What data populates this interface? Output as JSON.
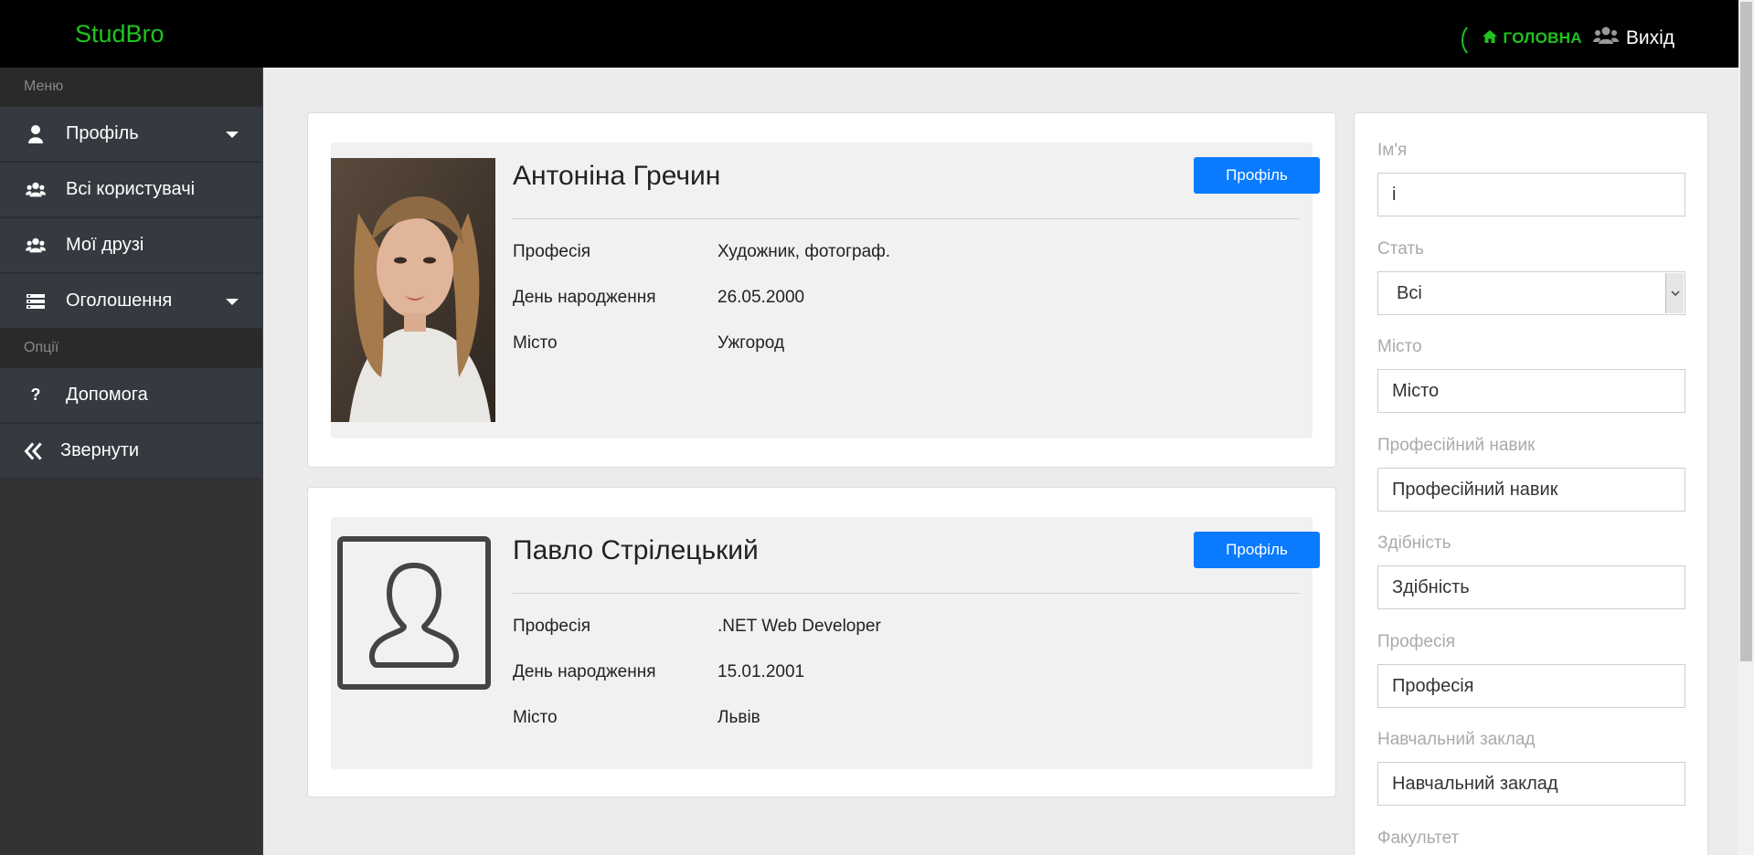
{
  "header": {
    "brand": "StudBro",
    "home_label": "ГОЛОВНА",
    "logout_label": "Вихід"
  },
  "sidebar": {
    "menu_title": "Меню",
    "options_title": "Опції",
    "items": [
      {
        "label": "Профіль",
        "icon": "user-icon",
        "has_caret": true
      },
      {
        "label": "Всі користувачі",
        "icon": "users-icon"
      },
      {
        "label": "Мої друзі",
        "icon": "users-icon"
      },
      {
        "label": "Оголошення",
        "icon": "list-icon",
        "has_caret": true
      }
    ],
    "option_items": [
      {
        "label": "Допомога",
        "icon": "question-icon"
      },
      {
        "label": "Звернути",
        "icon": "double-chevron-left-icon"
      }
    ]
  },
  "people": [
    {
      "name": "Антоніна Гречин",
      "button": "Профіль",
      "fields": [
        {
          "label": "Професія",
          "value": "Художник, фотограф."
        },
        {
          "label": "День народження",
          "value": "26.05.2000"
        },
        {
          "label": "Місто",
          "value": "Ужгород"
        }
      ]
    },
    {
      "name": "Павло Стрілецький",
      "button": "Профіль",
      "fields": [
        {
          "label": "Професія",
          "value": ".NET Web Developer"
        },
        {
          "label": "День народження",
          "value": "15.01.2001"
        },
        {
          "label": "Місто",
          "value": "Львів"
        }
      ]
    }
  ],
  "filters": {
    "name_label": "Ім'я",
    "name_value": "і",
    "gender_label": "Стать",
    "gender_value": "Всі",
    "city_label": "Місто",
    "city_placeholder": "Місто",
    "skill_label": "Професійний навик",
    "skill_placeholder": "Професійний навик",
    "ability_label": "Здібність",
    "ability_placeholder": "Здібність",
    "profession_label": "Професія",
    "profession_placeholder": "Професія",
    "school_label": "Навчальний заклад",
    "school_placeholder": "Навчальний заклад",
    "faculty_label": "Факультет"
  },
  "colors": {
    "brand_green": "#1fc41f",
    "button_blue": "#0a7bff",
    "sidebar_bg": "#343a40"
  }
}
